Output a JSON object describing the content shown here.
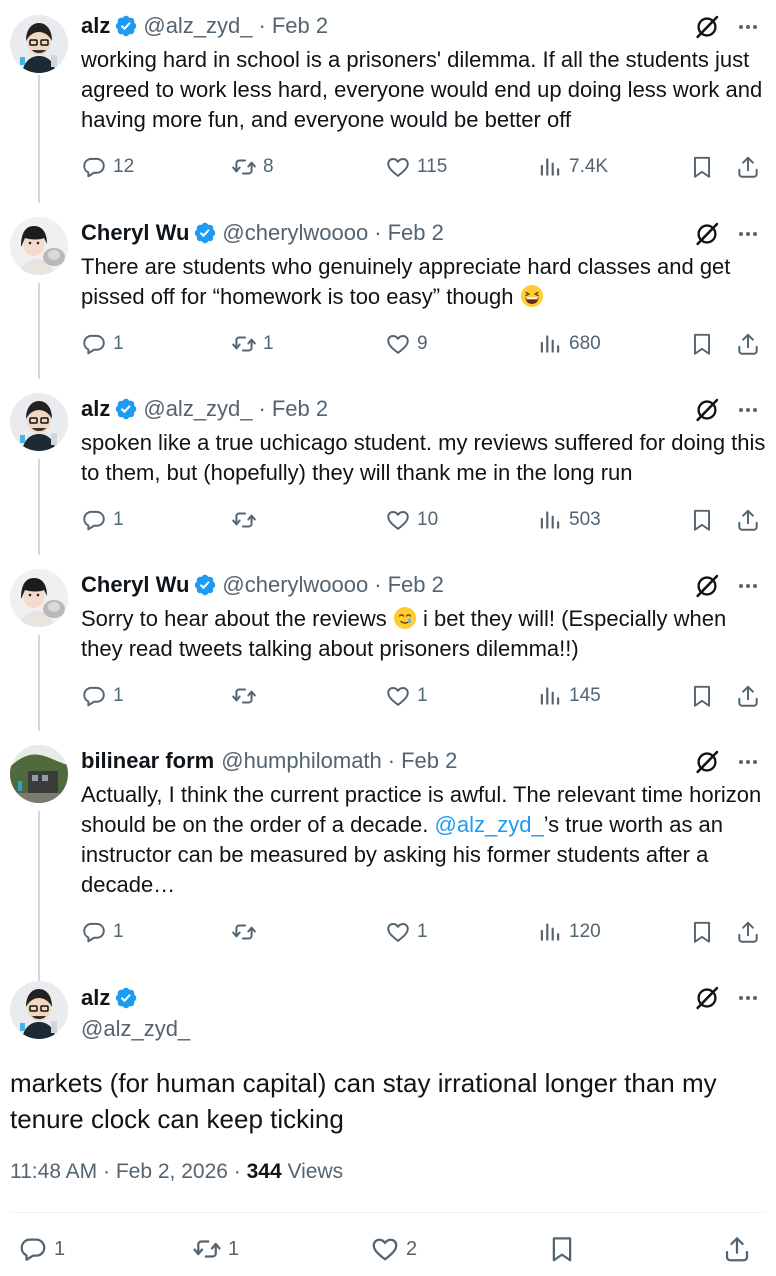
{
  "replies": [
    {
      "name": "alz",
      "handle": "@alz_zyd_",
      "date": "Feb 2",
      "text": "working hard in school is a prisoners' dilemma. If all the students just agreed to work less hard, everyone would end up doing less work and having more fun, and everyone would be better off",
      "reply_count": "12",
      "repost_count": "8",
      "like_count": "115",
      "view_count": "7.4K"
    },
    {
      "name": "Cheryl Wu",
      "handle": "@cherylwoooo",
      "date": "Feb 2",
      "text": "There are students who genuinely appreciate hard classes and get pissed off for “homework is too easy” though",
      "emoji": "grinning-squinting-face-emoji",
      "reply_count": "1",
      "repost_count": "1",
      "like_count": "9",
      "view_count": "680"
    },
    {
      "name": "alz",
      "handle": "@alz_zyd_",
      "date": "Feb 2",
      "text": "spoken like a true uchicago student. my reviews suffered for doing this to them, but (hopefully) they will thank me in the long run",
      "reply_count": "1",
      "repost_count": "",
      "like_count": "10",
      "view_count": "503"
    },
    {
      "name": "Cheryl Wu",
      "handle": "@cherylwoooo",
      "date": "Feb 2",
      "text_before": "Sorry to hear about the reviews",
      "text_after": "i bet they will! (Especially when they read tweets talking about prisoners dilemma!!)",
      "emoji": "smiling-face-with-tear-emoji",
      "reply_count": "1",
      "repost_count": "",
      "like_count": "1",
      "view_count": "145"
    },
    {
      "name": "bilinear form",
      "handle": "@humphilomath",
      "date": "Feb 2",
      "text_before": "Actually, I think the current practice is awful. The relevant time horizon should be on the order of a decade.",
      "mention": "@alz_zyd_",
      "text_after": "’s true worth as an instructor can be measured by asking his former students after a decade…",
      "reply_count": "1",
      "repost_count": "",
      "like_count": "1",
      "view_count": "120"
    }
  ],
  "main_post": {
    "name": "alz",
    "handle": "@alz_zyd_",
    "text": "markets (for human capital) can stay irrational longer than my tenure clock can keep ticking",
    "time": "11:48 AM",
    "date": "Feb 2, 2026",
    "views_count": "344",
    "views_label": "Views",
    "reply_count": "1",
    "repost_count": "1",
    "like_count": "2"
  },
  "colors": {
    "text": "#0f1419",
    "secondary": "#536471",
    "accent": "#1d9bf0",
    "verified": "#1d9bf0",
    "thread_line": "#cfd9de"
  },
  "icons": [
    "verified-badge-icon",
    "grok-icon",
    "more-icon",
    "reply-icon",
    "repost-icon",
    "like-icon",
    "views-icon",
    "bookmark-icon",
    "share-icon"
  ]
}
